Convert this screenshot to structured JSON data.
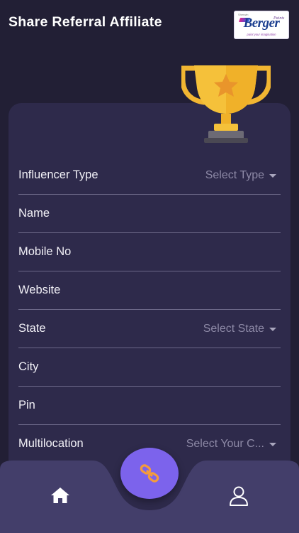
{
  "header": {
    "title": "Share Referral Affiliate",
    "logo": {
      "small_text": "Sherwin",
      "brand": "Berger",
      "sub": "Paints",
      "tagline": "paint your imagination"
    }
  },
  "form": {
    "fields": [
      {
        "label": "Influencer Type",
        "select": "Select Type"
      },
      {
        "label": "Name"
      },
      {
        "label": "Mobile No"
      },
      {
        "label": "Website"
      },
      {
        "label": "State",
        "select": "Select State"
      },
      {
        "label": "City"
      },
      {
        "label": "Pin"
      },
      {
        "label": "Multilocation",
        "select": "Select Your C..."
      }
    ]
  },
  "nav": {
    "items": [
      "home-icon",
      "link-icon",
      "user-icon"
    ]
  },
  "colors": {
    "background": "#221f35",
    "card": "#2e2a4b",
    "nav": "#433e6a",
    "accent": "#7c63ec",
    "trophy": "#f5c13a",
    "link_icon": "#f49b3c"
  }
}
